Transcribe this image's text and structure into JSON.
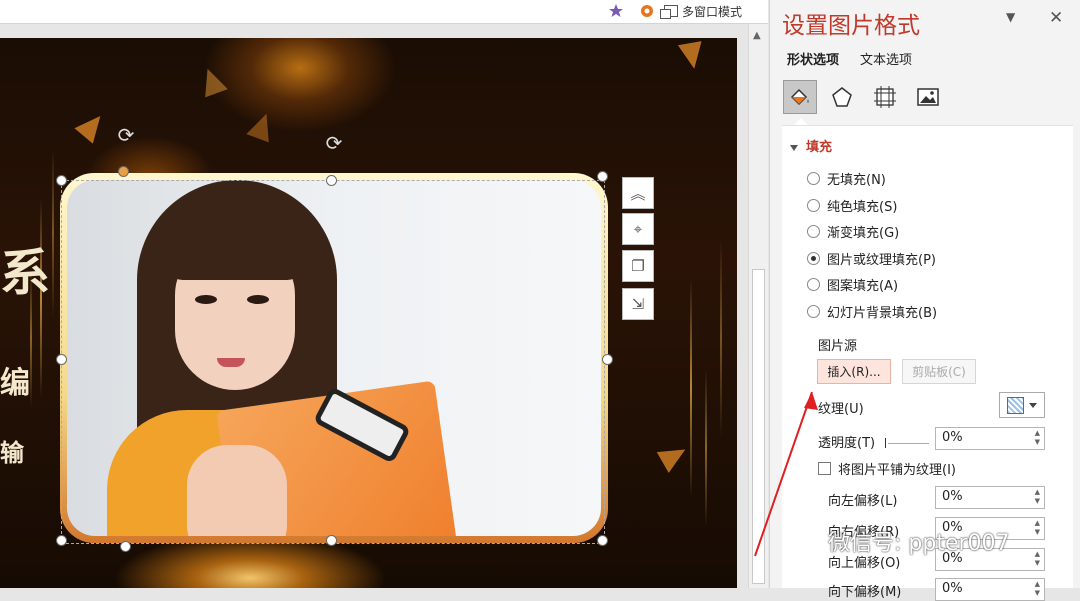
{
  "topbar": {
    "multiwindow_label": "多窗口模式"
  },
  "slide": {
    "left_chars": [
      "系",
      "编",
      "输"
    ]
  },
  "pane": {
    "title": "设置图片格式",
    "tabs": [
      "形状选项",
      "文本选项"
    ],
    "section_fill": "填充",
    "fill_options": [
      {
        "label": "无填充(N)",
        "selected": false
      },
      {
        "label": "纯色填充(S)",
        "selected": false
      },
      {
        "label": "渐变填充(G)",
        "selected": false
      },
      {
        "label": "图片或纹理填充(P)",
        "selected": true
      },
      {
        "label": "图案填充(A)",
        "selected": false
      },
      {
        "label": "幻灯片背景填充(B)",
        "selected": false
      }
    ],
    "picture_source_label": "图片源",
    "insert_button": "插入(R)...",
    "clipboard_button": "剪贴板(C)",
    "texture_label": "纹理(U)",
    "transparency_label": "透明度(T)",
    "transparency_value": "0%",
    "tile_checkbox": "将图片平铺为纹理(I)",
    "offset_left_label": "向左偏移(L)",
    "offset_left_value": "0%",
    "offset_right_label": "向右偏移(R)",
    "offset_right_value": "0%",
    "offset_up_label": "向上偏移(O)",
    "offset_up_value": "0%",
    "offset_down_label": "向下偏移(M)",
    "offset_down_value": "0%"
  },
  "watermark": "微信号: ppter007",
  "colors": {
    "accent": "#c0392b",
    "arrow": "#e02020"
  }
}
